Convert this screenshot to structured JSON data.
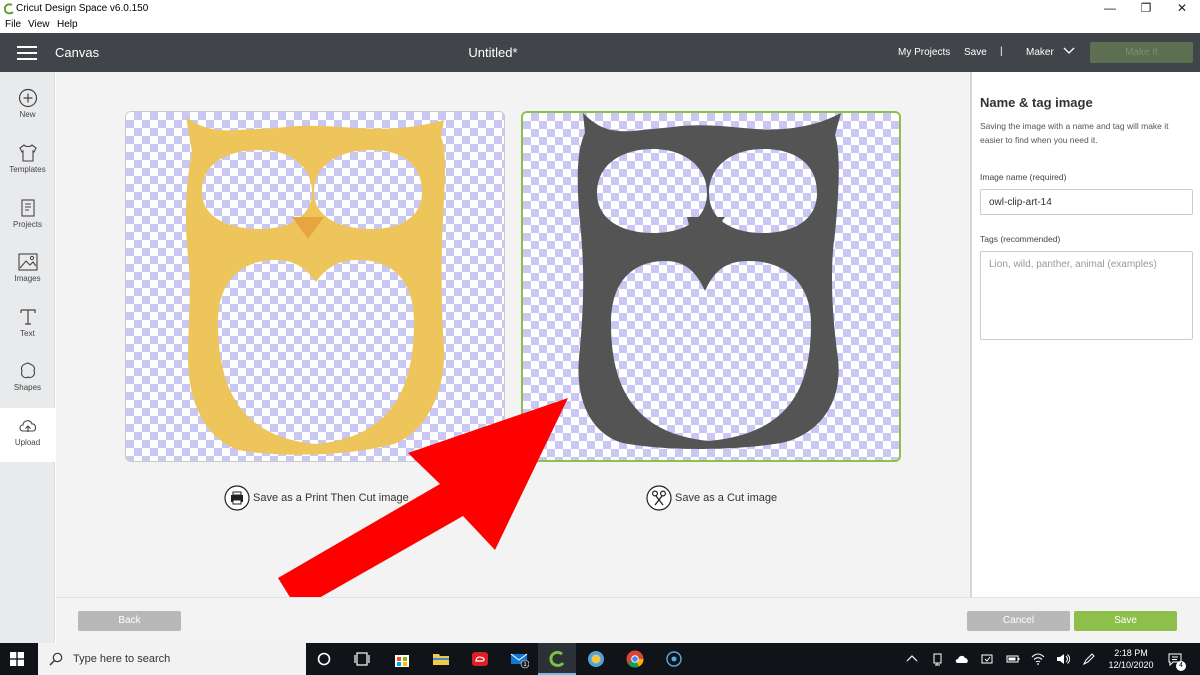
{
  "window": {
    "title": "Cricut Design Space  v6.0.150",
    "minimize": "—",
    "restore": "❐",
    "close": "✕"
  },
  "menu": {
    "items": [
      "File",
      "View",
      "Help"
    ]
  },
  "header": {
    "section": "Canvas",
    "doc_title": "Untitled*",
    "my_projects": "My Projects",
    "save": "Save",
    "separator": "|",
    "machine": "Maker",
    "make_it": "Make It"
  },
  "sidebar": {
    "items": [
      {
        "label": "New",
        "icon": "plus-circle-icon"
      },
      {
        "label": "Templates",
        "icon": "tshirt-icon"
      },
      {
        "label": "Projects",
        "icon": "projects-icon"
      },
      {
        "label": "Images",
        "icon": "image-icon"
      },
      {
        "label": "Text",
        "icon": "text-icon"
      },
      {
        "label": "Shapes",
        "icon": "shapes-icon"
      },
      {
        "label": "Upload",
        "icon": "cloud-upload-icon",
        "active": true
      }
    ]
  },
  "options": {
    "print_then_cut": "Save as a Print Then Cut image",
    "cut": "Save as a Cut image",
    "selected": "cut"
  },
  "colors": {
    "owl_print": "#edc55b",
    "owl_beak": "#e8a43f",
    "owl_cut": "#545454",
    "accent": "#8cc04a",
    "arrow": "#ff0000"
  },
  "footer": {
    "back": "Back",
    "cancel": "Cancel",
    "save": "Save"
  },
  "name_panel": {
    "title": "Name & tag image",
    "description": "Saving the image with a name and tag will make it easier to find when you need it.",
    "name_label": "Image name (required)",
    "name_value": "owl-clip-art-14",
    "tags_label": "Tags (recommended)",
    "tags_placeholder": "Lion, wild, panther, animal (examples)"
  },
  "taskbar": {
    "search_placeholder": "Type here to search",
    "time": "2:18 PM",
    "date": "12/10/2020",
    "mail_badge": "1",
    "notification_count": "4"
  }
}
